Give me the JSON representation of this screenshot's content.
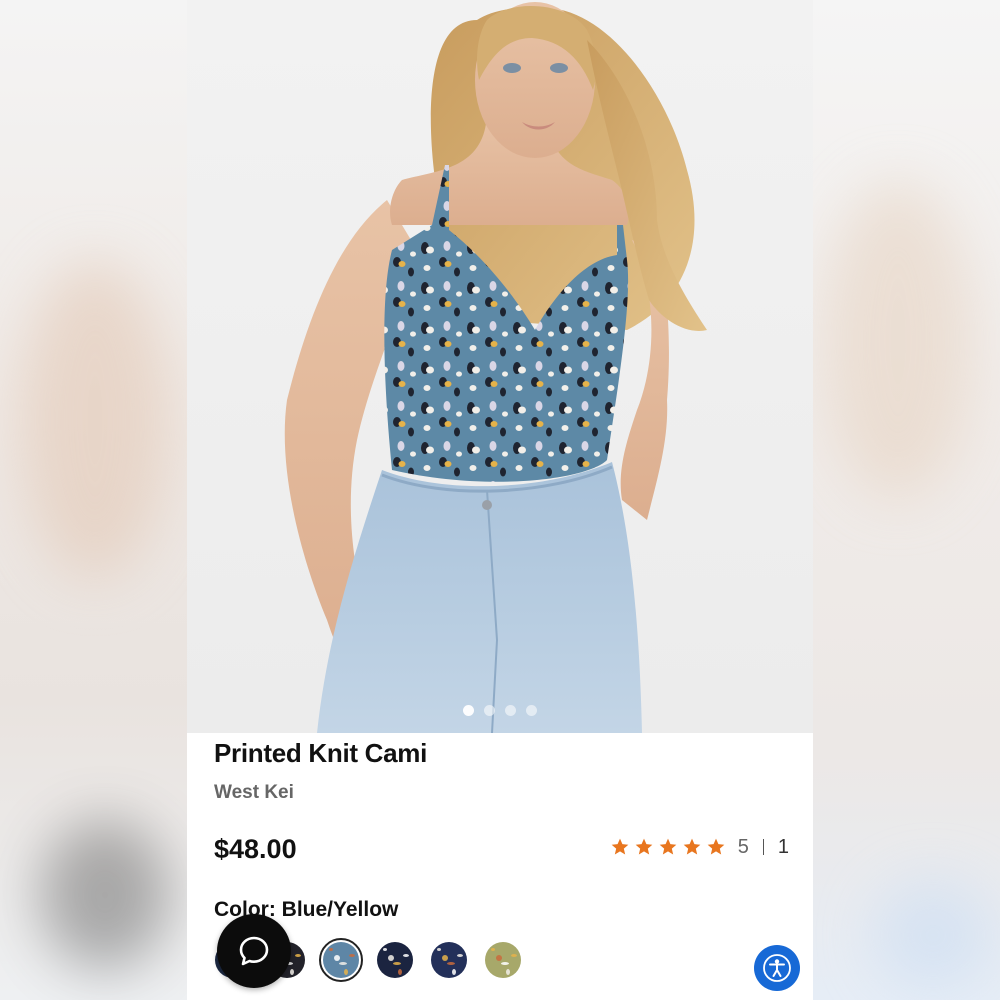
{
  "product": {
    "title": "Printed Knit Cami",
    "brand": "West Kei",
    "price": "$48.00",
    "rating": {
      "stars": 5,
      "value": "5",
      "count": "1"
    }
  },
  "color": {
    "label": "Color:",
    "selected": "Blue/Yellow",
    "swatches": [
      {
        "name": "navy-floral",
        "color": "#1d2a44"
      },
      {
        "name": "black-multi",
        "color": "#22222a"
      },
      {
        "name": "blue-yellow",
        "color": "#5e86a6"
      },
      {
        "name": "navy-dots",
        "color": "#1b2440"
      },
      {
        "name": "navy-white",
        "color": "#23305a"
      },
      {
        "name": "olive-camo",
        "color": "#a7a86a"
      }
    ]
  },
  "gallery": {
    "image_count": 4,
    "active_index": 0
  },
  "icons": {
    "chat": "chat-bubble-icon",
    "accessibility": "accessibility-icon",
    "star": "star-icon"
  },
  "colors": {
    "star": "#e8761f",
    "accessibility_button": "#1769d6",
    "chat_button": "#0c0c0c"
  }
}
